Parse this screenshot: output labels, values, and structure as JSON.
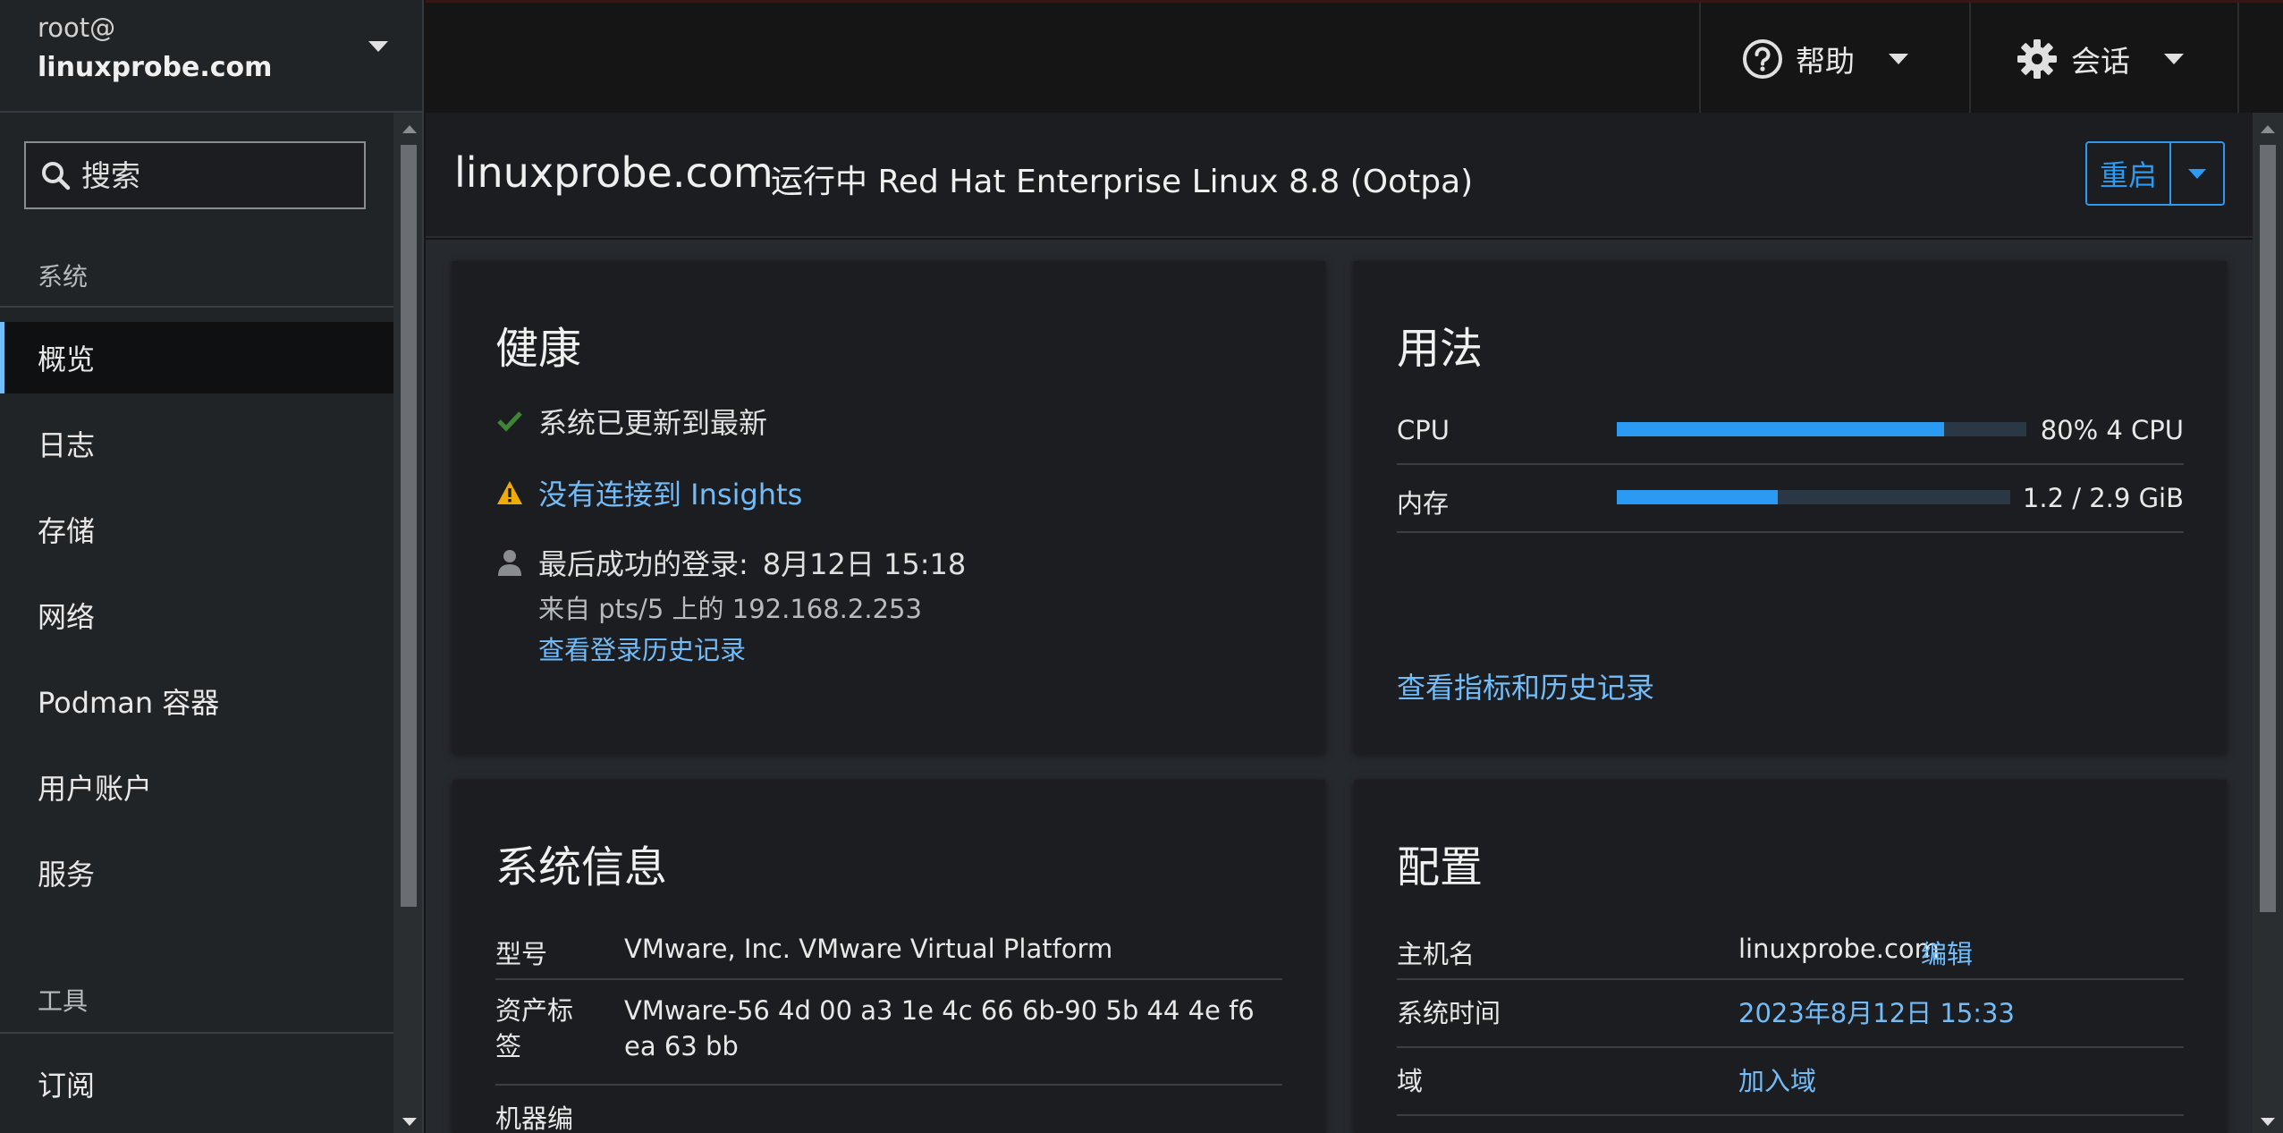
{
  "host_switcher": {
    "user": "root@",
    "host": "linuxprobe.com"
  },
  "sidebar": {
    "search_placeholder": "搜索",
    "section_system": "系统",
    "items": [
      {
        "label": "概览",
        "active": true
      },
      {
        "label": "日志"
      },
      {
        "label": "存储"
      },
      {
        "label": "网络"
      },
      {
        "label": "Podman 容器"
      },
      {
        "label": "用户账户"
      },
      {
        "label": "服务"
      }
    ],
    "section_tools": "工具",
    "tools_items": [
      {
        "label": "订阅"
      }
    ]
  },
  "topbar": {
    "help_label": "帮助",
    "session_label": "会话"
  },
  "header": {
    "hostname": "linuxprobe.com",
    "status": "运行中 Red Hat Enterprise Linux 8.8 (Ootpa)",
    "restart_label": "重启"
  },
  "health": {
    "title": "健康",
    "updated": "系统已更新到最新",
    "insights_link": "没有连接到 Insights",
    "last_login_label": "最后成功的登录:",
    "last_login_time": "8月12日 15:18",
    "last_login_from": "来自 pts/5 上的 192.168.2.253",
    "login_history_link": "查看登录历史记录"
  },
  "usage": {
    "title": "用法",
    "cpu_label": "CPU",
    "cpu_fraction": 0.8,
    "cpu_value": "80% 4 CPU",
    "mem_label": "内存",
    "mem_fraction": 0.41,
    "mem_value": "1.2 / 2.9 GiB",
    "metrics_link": "查看指标和历史记录"
  },
  "sysinfo": {
    "title": "系统信息",
    "rows": [
      {
        "key": "型号",
        "value": "VMware, Inc. VMware Virtual Platform"
      },
      {
        "key": "资产标签",
        "value": "VMware-56 4d 00 a3 1e 4c 66 6b-90 5b 44 4e f6 ea 63 bb"
      },
      {
        "key": "机器编",
        "value": ""
      }
    ]
  },
  "config": {
    "title": "配置",
    "hostname_key": "主机名",
    "hostname_value": "linuxprobe.com",
    "hostname_edit": "编辑",
    "time_key": "系统时间",
    "time_value": "2023年8月12日 15:33",
    "domain_key": "域",
    "domain_value": "加入域"
  },
  "colors": {
    "accent": "#2b9af3",
    "link": "#73bcf7",
    "success": "#3e8635",
    "warning": "#f0ab00"
  }
}
